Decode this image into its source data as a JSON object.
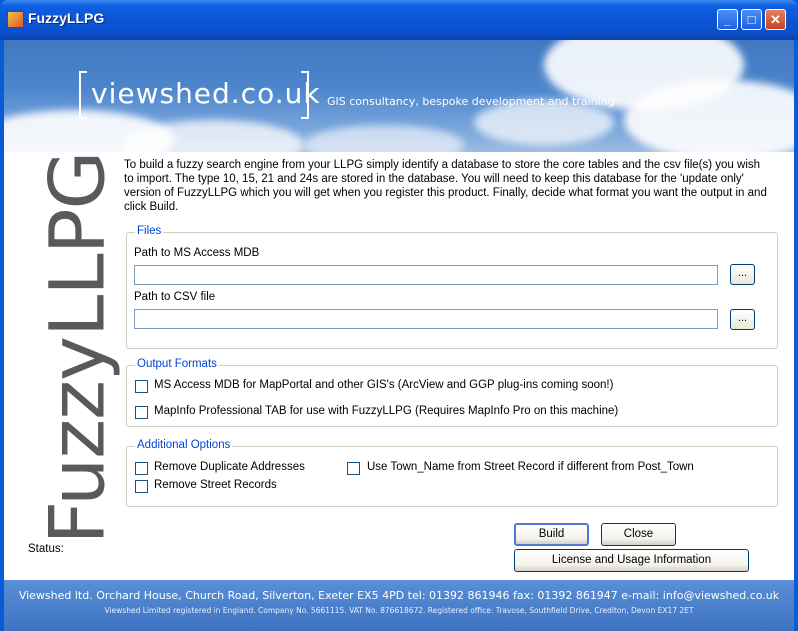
{
  "window": {
    "title": "FuzzyLLPG",
    "controls": {
      "minimize": "_",
      "maximize": "□",
      "close": "✕"
    }
  },
  "banner": {
    "logo": "viewshed.co.uk",
    "tagline": "GIS consultancy, bespoke development and training"
  },
  "side_title": "FuzzyLLPG",
  "intro": "To build a fuzzy search engine from your LLPG simply identify a database to store the core tables and the csv file(s) you wish to import. The type 10, 15, 21 and 24s are stored in the database. You will need to keep this database for the  'update only' version of FuzzyLLPG which you will get when you register this product. Finally, decide what format you want the output in and click Build.",
  "files": {
    "legend": "Files",
    "mdb_label": "Path to MS Access MDB",
    "mdb_value": "",
    "csv_label": "Path to CSV file",
    "csv_value": "",
    "browse_label": "..."
  },
  "output_formats": {
    "legend": "Output Formats",
    "options": [
      {
        "label": "MS Access MDB for MapPortal and other GIS's (ArcView and GGP plug-ins coming soon!)",
        "checked": false
      },
      {
        "label": "MapInfo Professional TAB for use with FuzzyLLPG (Requires MapInfo Pro on this machine)",
        "checked": false
      }
    ]
  },
  "additional_options": {
    "legend": "Additional Options",
    "options": [
      {
        "label": "Remove Duplicate Addresses",
        "checked": false
      },
      {
        "label": "Remove Street Records",
        "checked": false
      },
      {
        "label": "Use Town_Name from Street Record if different from  Post_Town",
        "checked": false
      }
    ]
  },
  "buttons": {
    "build": "Build",
    "close": "Close",
    "license": "License and Usage Information"
  },
  "status_label": "Status:",
  "footer": {
    "line1": "Viewshed ltd. Orchard House, Church Road, Silverton, Exeter EX5 4PD  tel: 01392 861946  fax: 01392 861947  e-mail: info@viewshed.co.uk",
    "line2": "Viewshed Limited registered in England. Company No. 5661115. VAT No. 876618672. Registered office: Travose, Southfield Drive, Crediton, Devon EX17 2ET"
  },
  "colors": {
    "titlebar": "#0a54d4",
    "legend_text": "#0046d5",
    "footer": "#4a80cc"
  }
}
